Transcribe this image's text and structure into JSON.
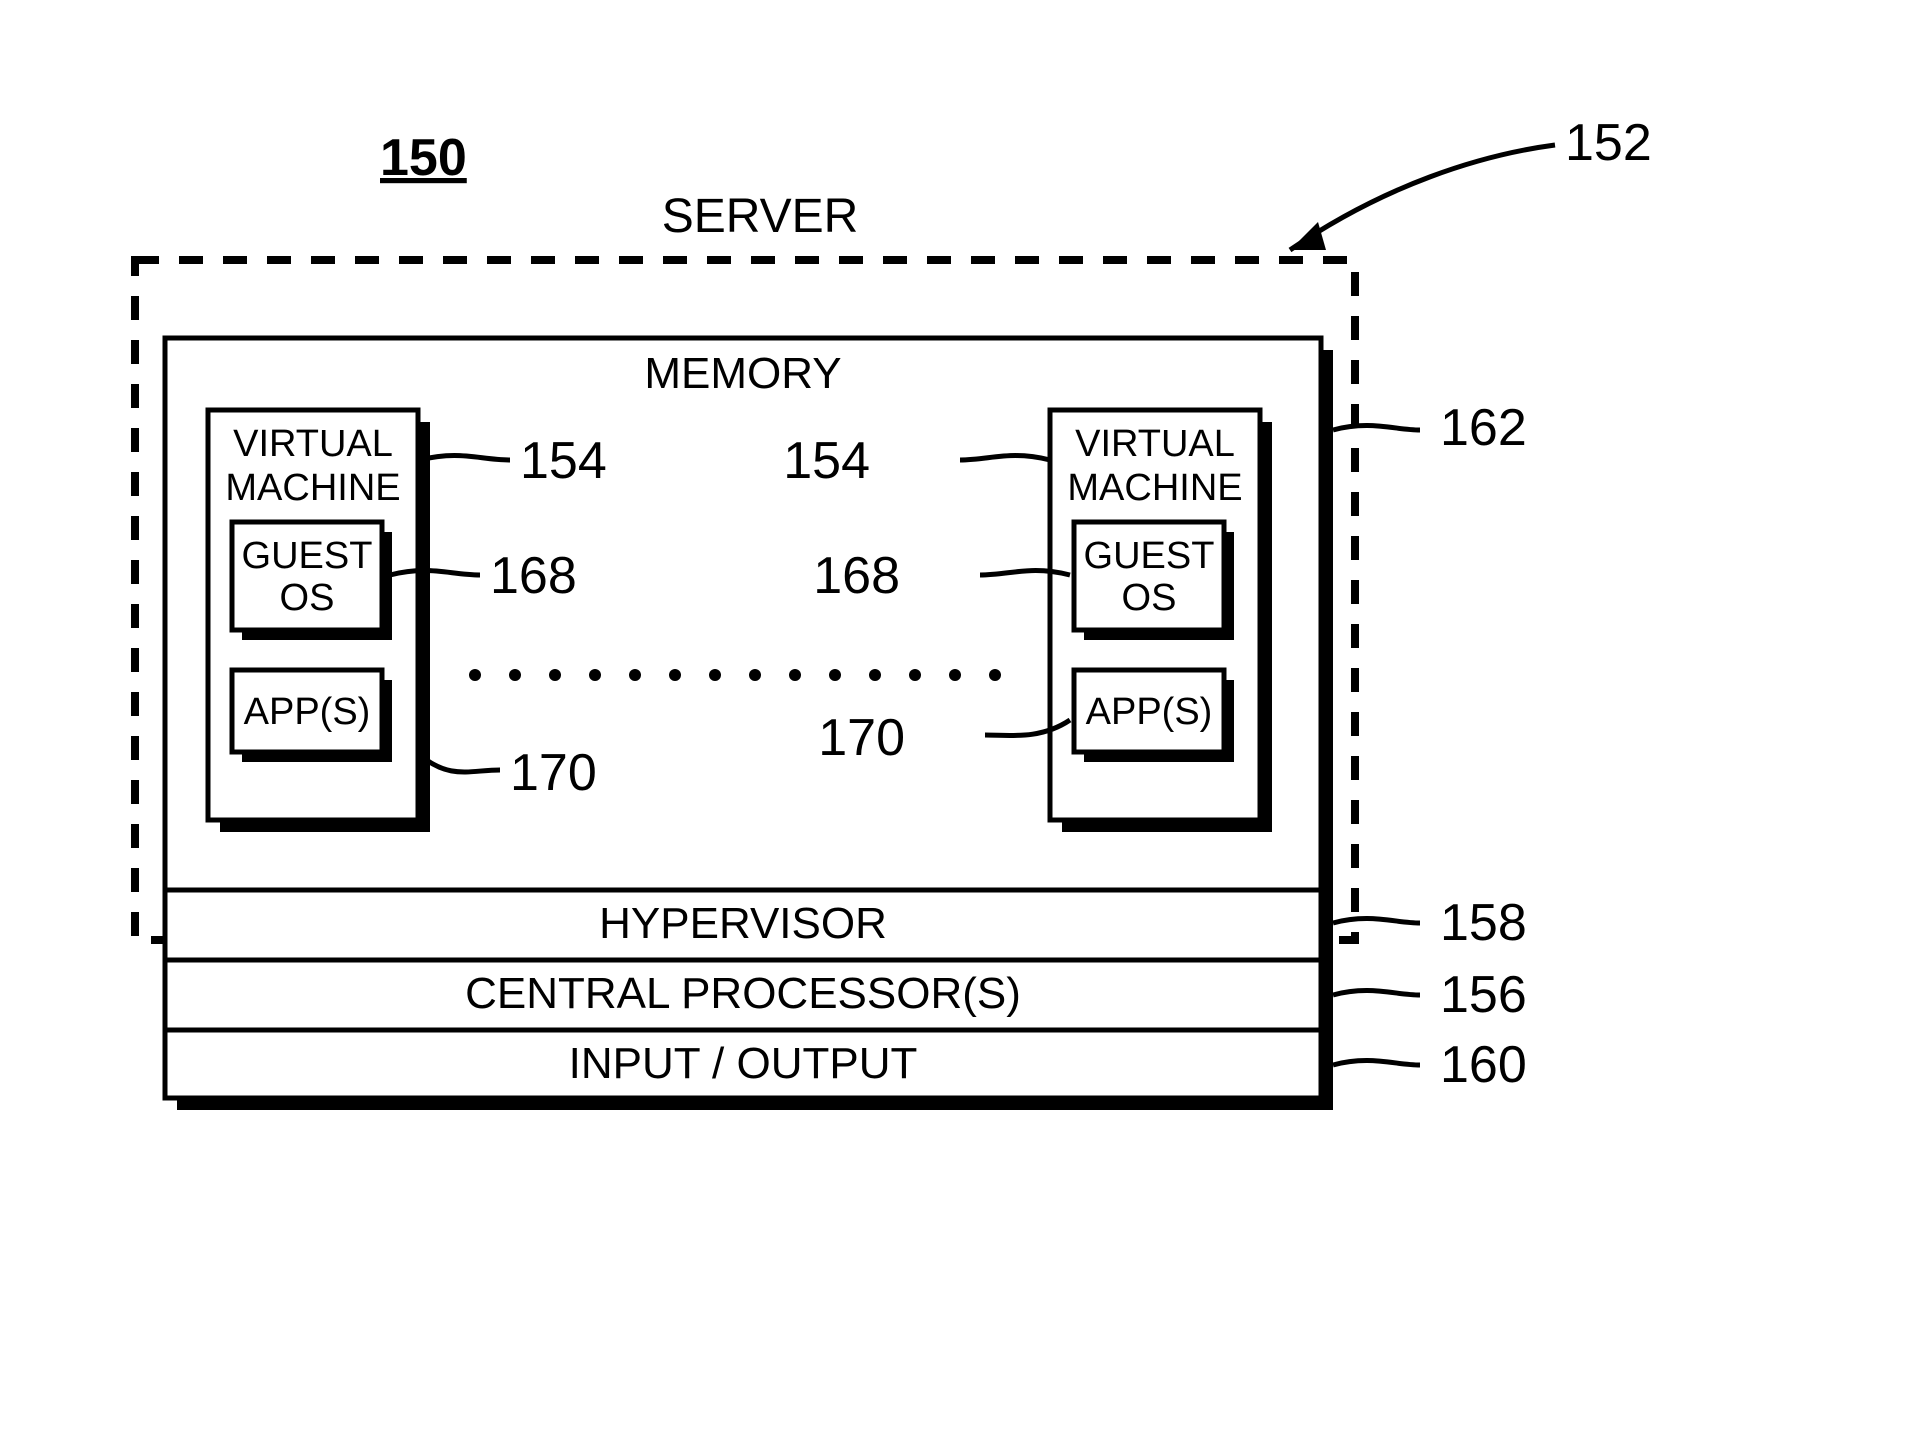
{
  "figure_number": "150",
  "server_label": "SERVER",
  "server_ref": "152",
  "memory": {
    "label": "MEMORY",
    "ref": "162"
  },
  "layers": {
    "hypervisor": {
      "label": "HYPERVISOR",
      "ref": "158"
    },
    "cpu": {
      "label": "CENTRAL PROCESSOR(S)",
      "ref": "156"
    },
    "io": {
      "label": "INPUT / OUTPUT",
      "ref": "160"
    }
  },
  "vm": {
    "title_l1": "VIRTUAL",
    "title_l2": "MACHINE",
    "ref": "154",
    "guest_os": {
      "l1": "GUEST",
      "l2": "OS",
      "ref": "168"
    },
    "apps": {
      "label": "APP(S)",
      "ref": "170"
    }
  }
}
